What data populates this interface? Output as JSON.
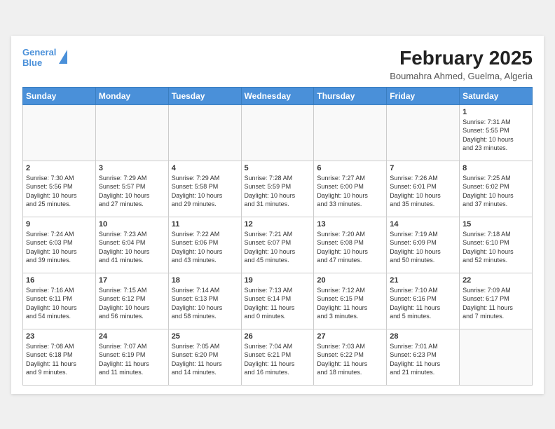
{
  "header": {
    "title": "February 2025",
    "subtitle": "Boumahra Ahmed, Guelma, Algeria",
    "logo_line1": "General",
    "logo_line2": "Blue"
  },
  "weekdays": [
    "Sunday",
    "Monday",
    "Tuesday",
    "Wednesday",
    "Thursday",
    "Friday",
    "Saturday"
  ],
  "weeks": [
    [
      {
        "day": "",
        "info": ""
      },
      {
        "day": "",
        "info": ""
      },
      {
        "day": "",
        "info": ""
      },
      {
        "day": "",
        "info": ""
      },
      {
        "day": "",
        "info": ""
      },
      {
        "day": "",
        "info": ""
      },
      {
        "day": "1",
        "info": "Sunrise: 7:31 AM\nSunset: 5:55 PM\nDaylight: 10 hours\nand 23 minutes."
      }
    ],
    [
      {
        "day": "2",
        "info": "Sunrise: 7:30 AM\nSunset: 5:56 PM\nDaylight: 10 hours\nand 25 minutes."
      },
      {
        "day": "3",
        "info": "Sunrise: 7:29 AM\nSunset: 5:57 PM\nDaylight: 10 hours\nand 27 minutes."
      },
      {
        "day": "4",
        "info": "Sunrise: 7:29 AM\nSunset: 5:58 PM\nDaylight: 10 hours\nand 29 minutes."
      },
      {
        "day": "5",
        "info": "Sunrise: 7:28 AM\nSunset: 5:59 PM\nDaylight: 10 hours\nand 31 minutes."
      },
      {
        "day": "6",
        "info": "Sunrise: 7:27 AM\nSunset: 6:00 PM\nDaylight: 10 hours\nand 33 minutes."
      },
      {
        "day": "7",
        "info": "Sunrise: 7:26 AM\nSunset: 6:01 PM\nDaylight: 10 hours\nand 35 minutes."
      },
      {
        "day": "8",
        "info": "Sunrise: 7:25 AM\nSunset: 6:02 PM\nDaylight: 10 hours\nand 37 minutes."
      }
    ],
    [
      {
        "day": "9",
        "info": "Sunrise: 7:24 AM\nSunset: 6:03 PM\nDaylight: 10 hours\nand 39 minutes."
      },
      {
        "day": "10",
        "info": "Sunrise: 7:23 AM\nSunset: 6:04 PM\nDaylight: 10 hours\nand 41 minutes."
      },
      {
        "day": "11",
        "info": "Sunrise: 7:22 AM\nSunset: 6:06 PM\nDaylight: 10 hours\nand 43 minutes."
      },
      {
        "day": "12",
        "info": "Sunrise: 7:21 AM\nSunset: 6:07 PM\nDaylight: 10 hours\nand 45 minutes."
      },
      {
        "day": "13",
        "info": "Sunrise: 7:20 AM\nSunset: 6:08 PM\nDaylight: 10 hours\nand 47 minutes."
      },
      {
        "day": "14",
        "info": "Sunrise: 7:19 AM\nSunset: 6:09 PM\nDaylight: 10 hours\nand 50 minutes."
      },
      {
        "day": "15",
        "info": "Sunrise: 7:18 AM\nSunset: 6:10 PM\nDaylight: 10 hours\nand 52 minutes."
      }
    ],
    [
      {
        "day": "16",
        "info": "Sunrise: 7:16 AM\nSunset: 6:11 PM\nDaylight: 10 hours\nand 54 minutes."
      },
      {
        "day": "17",
        "info": "Sunrise: 7:15 AM\nSunset: 6:12 PM\nDaylight: 10 hours\nand 56 minutes."
      },
      {
        "day": "18",
        "info": "Sunrise: 7:14 AM\nSunset: 6:13 PM\nDaylight: 10 hours\nand 58 minutes."
      },
      {
        "day": "19",
        "info": "Sunrise: 7:13 AM\nSunset: 6:14 PM\nDaylight: 11 hours\nand 0 minutes."
      },
      {
        "day": "20",
        "info": "Sunrise: 7:12 AM\nSunset: 6:15 PM\nDaylight: 11 hours\nand 3 minutes."
      },
      {
        "day": "21",
        "info": "Sunrise: 7:10 AM\nSunset: 6:16 PM\nDaylight: 11 hours\nand 5 minutes."
      },
      {
        "day": "22",
        "info": "Sunrise: 7:09 AM\nSunset: 6:17 PM\nDaylight: 11 hours\nand 7 minutes."
      }
    ],
    [
      {
        "day": "23",
        "info": "Sunrise: 7:08 AM\nSunset: 6:18 PM\nDaylight: 11 hours\nand 9 minutes."
      },
      {
        "day": "24",
        "info": "Sunrise: 7:07 AM\nSunset: 6:19 PM\nDaylight: 11 hours\nand 11 minutes."
      },
      {
        "day": "25",
        "info": "Sunrise: 7:05 AM\nSunset: 6:20 PM\nDaylight: 11 hours\nand 14 minutes."
      },
      {
        "day": "26",
        "info": "Sunrise: 7:04 AM\nSunset: 6:21 PM\nDaylight: 11 hours\nand 16 minutes."
      },
      {
        "day": "27",
        "info": "Sunrise: 7:03 AM\nSunset: 6:22 PM\nDaylight: 11 hours\nand 18 minutes."
      },
      {
        "day": "28",
        "info": "Sunrise: 7:01 AM\nSunset: 6:23 PM\nDaylight: 11 hours\nand 21 minutes."
      },
      {
        "day": "",
        "info": ""
      }
    ]
  ]
}
